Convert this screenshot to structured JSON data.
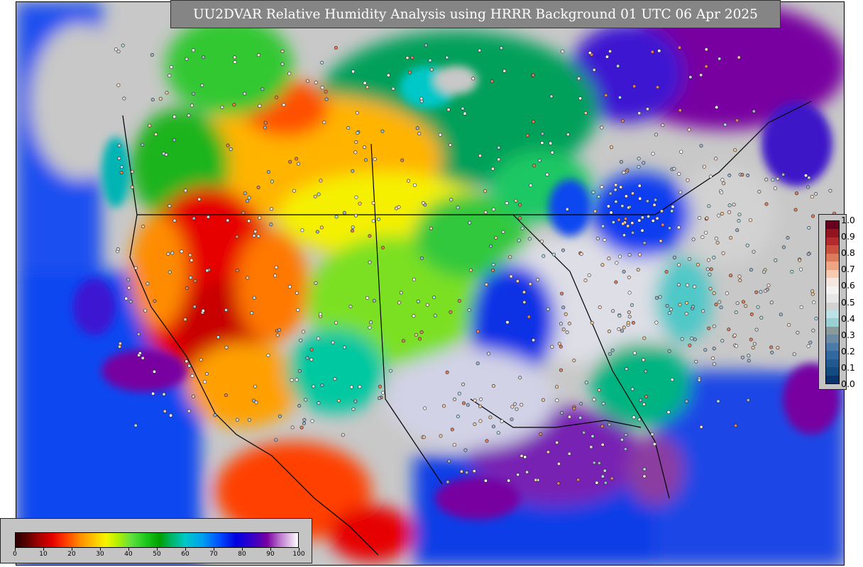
{
  "title": "UU2DVAR Relative Humidity Analysis using HRRR Background 01 UTC 06 Apr 2025",
  "rh_colorbar": {
    "ticks": [
      "0",
      "10",
      "20",
      "30",
      "40",
      "50",
      "60",
      "70",
      "80",
      "90",
      "100"
    ]
  },
  "increment_colorbar": {
    "ticks": [
      "1.0",
      "0.9",
      "0.8",
      "0.7",
      "0.6",
      "0.5",
      "0.4",
      "0.3",
      "0.2",
      "0.1",
      "0.0"
    ],
    "colors": [
      "#67001f",
      "#92141e",
      "#b2292e",
      "#c9503d",
      "#dc7b5c",
      "#eda583",
      "#f7cbb0",
      "#f5e7df",
      "#f2f2f2",
      "#e6e6e6",
      "#d2d2d2",
      "#bde2e6",
      "#9ad0d5",
      "#8a9a9a",
      "#6d8aa3",
      "#4a7aa6",
      "#30689f",
      "#1f5990",
      "#134a80",
      "#08336b"
    ]
  },
  "colors": {
    "ocean_low": "#0a3cf0",
    "land_dry": "#e60000",
    "moist": "#7800a0",
    "missing": "#c8c8c8"
  }
}
